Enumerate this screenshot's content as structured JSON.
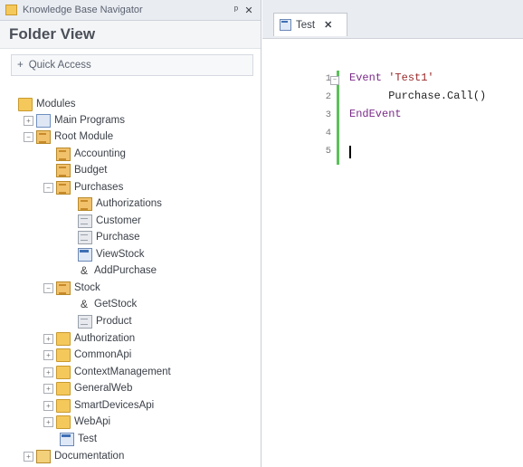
{
  "navigator": {
    "title": "Knowledge Base Navigator",
    "pin_icon": "pin-icon",
    "close_icon": "close-icon",
    "heading": "Folder View",
    "quick_access": "Quick Access"
  },
  "tree": {
    "items": [
      {
        "label": "Modules"
      },
      {
        "label": "Main Programs"
      },
      {
        "label": "Root Module"
      },
      {
        "label": "Accounting"
      },
      {
        "label": "Budget"
      },
      {
        "label": "Purchases"
      },
      {
        "label": "Authorizations"
      },
      {
        "label": "Customer"
      },
      {
        "label": "Purchase"
      },
      {
        "label": "ViewStock"
      },
      {
        "label": "AddPurchase"
      },
      {
        "label": "Stock"
      },
      {
        "label": "GetStock"
      },
      {
        "label": "Product"
      },
      {
        "label": "Authorization"
      },
      {
        "label": "CommonApi"
      },
      {
        "label": "ContextManagement"
      },
      {
        "label": "GeneralWeb"
      },
      {
        "label": "SmartDevicesApi"
      },
      {
        "label": "WebApi"
      },
      {
        "label": "Test"
      },
      {
        "label": "Documentation"
      }
    ]
  },
  "editor": {
    "tab_label": "Test",
    "tab_close": "✕",
    "lines": [
      {
        "num": "1",
        "a": "Event ",
        "b": "'Test1'"
      },
      {
        "num": "2",
        "a": "      Purchase.Call()",
        "b": ""
      },
      {
        "num": "3",
        "a": "EndEvent",
        "b": ""
      },
      {
        "num": "4",
        "a": "",
        "b": ""
      },
      {
        "num": "5",
        "a": "",
        "b": ""
      }
    ]
  },
  "colors": {
    "accent_green": "#5cc05a",
    "keyword": "#7a2a88",
    "string": "#9a2a2a"
  }
}
